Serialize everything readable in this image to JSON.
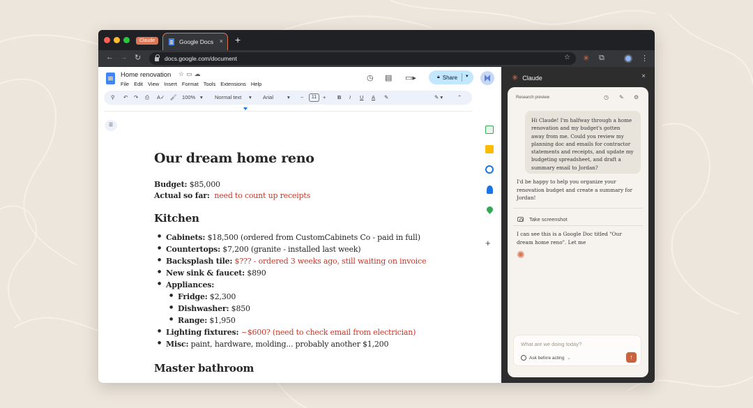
{
  "browser": {
    "tab_group_label": "Claude",
    "tab_title": "Google Docs",
    "tab_close": "×",
    "new_tab": "+",
    "url": "docs.google.com/document",
    "icons": [
      "back-icon",
      "forward-icon",
      "reload-icon",
      "star-icon",
      "claude-extension-icon",
      "puzzle-extension-icon",
      "profile-icon",
      "menu-icon"
    ]
  },
  "docs": {
    "title": "Home renovation",
    "menu": [
      "File",
      "Edit",
      "View",
      "Insert",
      "Format",
      "Tools",
      "Extensions",
      "Help"
    ],
    "share_label": "Share",
    "toolbar": {
      "zoom": "100%",
      "style": "Normal text",
      "font": "Arial",
      "font_size": "11"
    },
    "content": {
      "heading": "Our dream home reno",
      "budget_label": "Budget:",
      "budget_value": " $85,000",
      "actual_label": "Actual so far:",
      "actual_value": "need to count up receipts",
      "kitchen_heading": "Kitchen",
      "kitchen_items": [
        {
          "label": "Cabinets:",
          "value": " $18,500 (ordered from CustomCabinets Co - paid in full)",
          "red": ""
        },
        {
          "label": "Countertops:",
          "value": " $7,200 (granite - installed last week)",
          "red": ""
        },
        {
          "label": "Backsplash tile:",
          "value": "",
          "red": " $??? - ordered 3 weeks ago, still waiting on invoice"
        },
        {
          "label": "New sink & faucet:",
          "value": " $890",
          "red": ""
        },
        {
          "label": "Appliances:",
          "value": "",
          "red": ""
        },
        {
          "label": "Fridge:",
          "value": " $2,300",
          "red": ""
        },
        {
          "label": "Dishwasher:",
          "value": " $850",
          "red": ""
        },
        {
          "label": "Range:",
          "value": " $1,950",
          "red": ""
        },
        {
          "label": "Lighting fixtures:",
          "value": "",
          "red": " ~$600? (need to check email from electrician)"
        },
        {
          "label": "Misc:",
          "value": " paint, hardware, molding... probably another $1,200",
          "red": ""
        }
      ],
      "bath_heading": "Master bathroom"
    }
  },
  "claude": {
    "panel_title": "Claude",
    "close": "×",
    "research_preview": "Research preview",
    "user_message": "Hi Claude! I'm halfway through a home renovation and my budget's gotten away from me. Could you review my planning doc and emails for contractor statements and receipts, and update my budgeting spreadsheet, and draft a summary email to Jordan?",
    "assistant_message_1": "I'd be happy to help you organize your renovation budget and create a summary for Jordan!",
    "action_label": "Take screenshot",
    "assistant_message_2": "I can see this is a Google Doc titled \"Our dream home reno\". Let me",
    "input_placeholder": "What are we doing today?",
    "mode_label": "Ask before acting",
    "send": "↑",
    "colors": {
      "accent": "#d97757",
      "send_button": "#c9623e",
      "panel_bg": "#2d2d2d",
      "card_bg": "#f6f3ee"
    }
  }
}
